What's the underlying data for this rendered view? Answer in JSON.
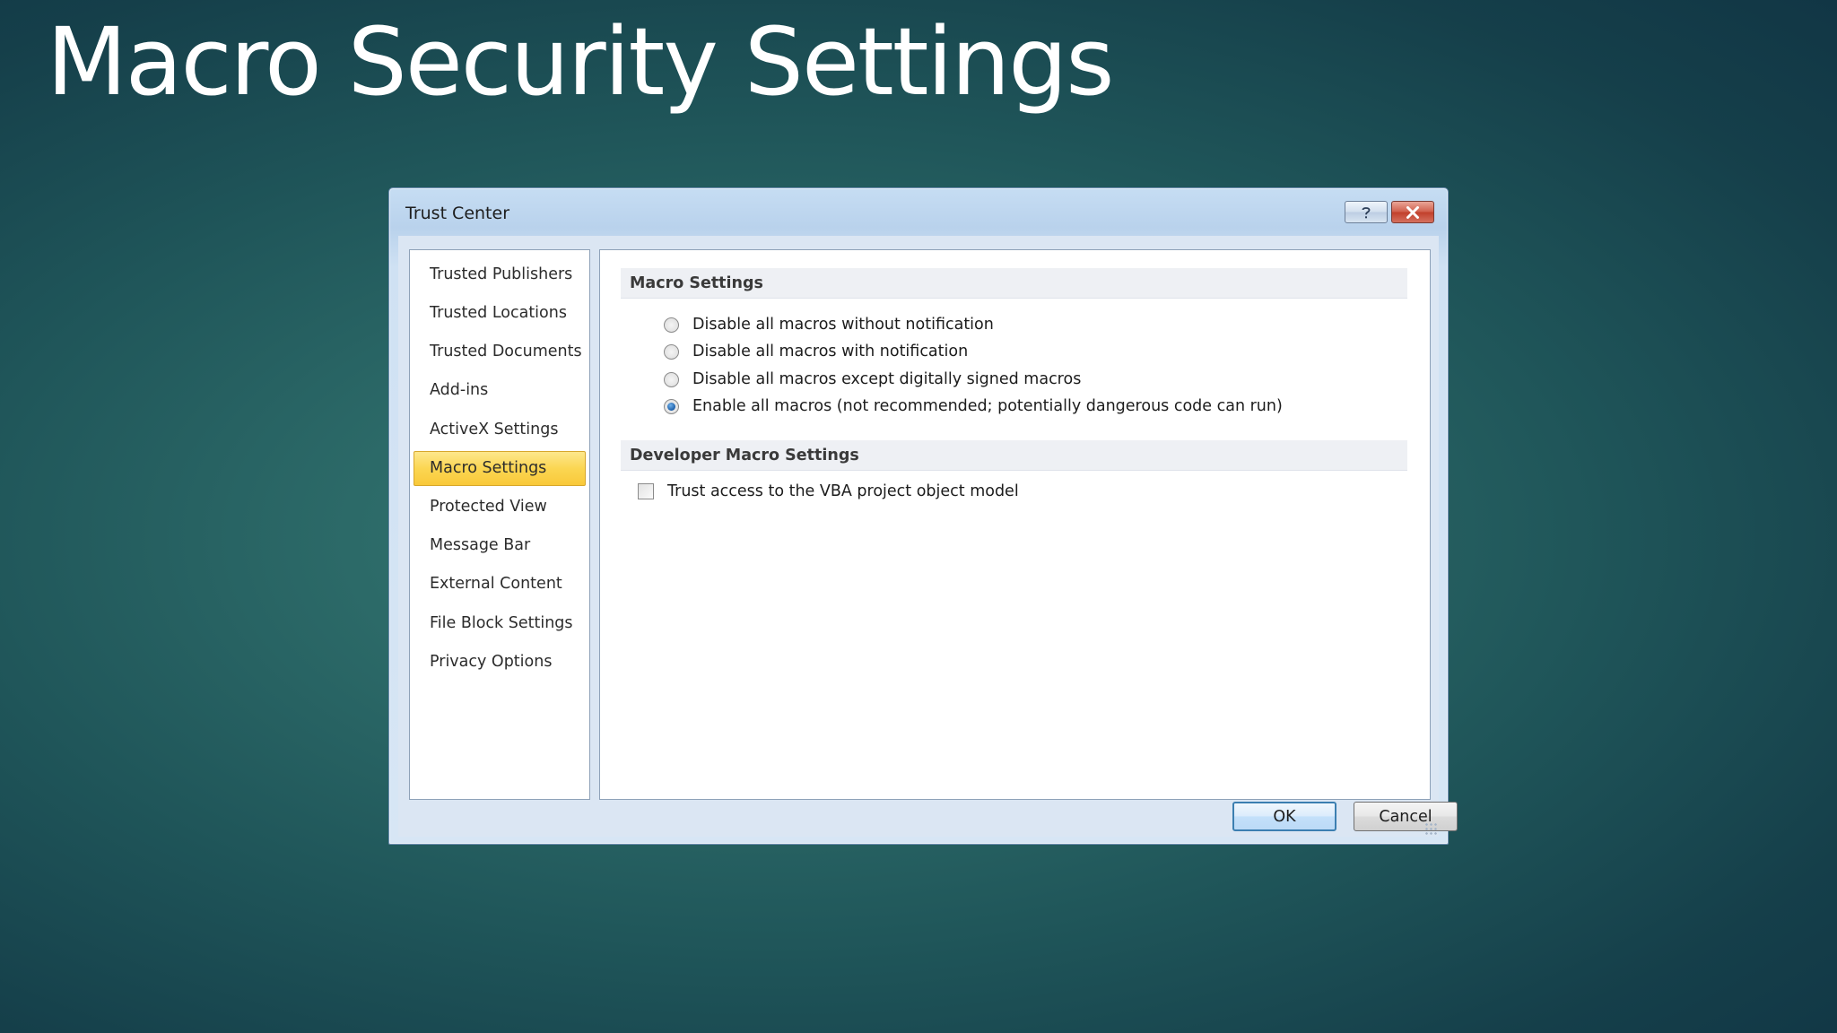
{
  "slide": {
    "title": "Macro Security Settings"
  },
  "dialog": {
    "title": "Trust Center",
    "help_icon": "question-mark-icon",
    "close_icon": "close-x-icon",
    "nav_items": [
      {
        "label": "Trusted Publishers"
      },
      {
        "label": "Trusted Locations"
      },
      {
        "label": "Trusted Documents"
      },
      {
        "label": "Add-ins"
      },
      {
        "label": "ActiveX Settings"
      },
      {
        "label": "Macro Settings",
        "selected": true
      },
      {
        "label": "Protected View"
      },
      {
        "label": "Message Bar"
      },
      {
        "label": "External Content"
      },
      {
        "label": "File Block Settings"
      },
      {
        "label": "Privacy Options"
      }
    ],
    "macro_section": {
      "header": "Macro Settings",
      "options": [
        {
          "label": "Disable all macros without notification",
          "checked": false
        },
        {
          "label": "Disable all macros with notification",
          "checked": false
        },
        {
          "label": "Disable all macros except digitally signed macros",
          "checked": false
        },
        {
          "label": "Enable all macros (not recommended; potentially dangerous code can run)",
          "checked": true
        }
      ]
    },
    "developer_section": {
      "header": "Developer Macro Settings",
      "vba_access_label": "Trust access to the VBA project object model",
      "vba_access_checked": false
    },
    "ok_label": "OK",
    "cancel_label": "Cancel"
  },
  "colors": {
    "selected_item": "#fbd652",
    "radio_selected": "#1c5ea8",
    "default_button_border": "#3c7fb1"
  }
}
